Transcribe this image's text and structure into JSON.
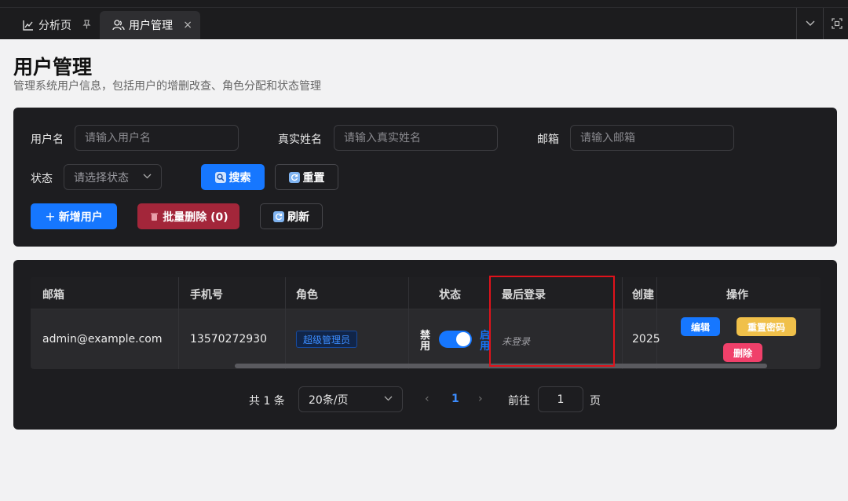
{
  "tabs": [
    {
      "label": "分析页",
      "icon": "chart-icon",
      "pin": "pin-icon"
    },
    {
      "label": "用户管理",
      "icon": "users-icon",
      "close": "×"
    }
  ],
  "header": {
    "title": "用户管理",
    "subtitle": "管理系统用户信息，包括用户的增删改查、角色分配和状态管理"
  },
  "filters": {
    "username_label": "用户名",
    "username_placeholder": "请输入用户名",
    "realname_label": "真实姓名",
    "realname_placeholder": "请输入真实姓名",
    "email_label": "邮箱",
    "email_placeholder": "请输入邮箱",
    "status_label": "状态",
    "status_placeholder": "请选择状态",
    "search_label": "搜索",
    "reset_label": "重置"
  },
  "actions": {
    "add_label": "新增用户",
    "batch_delete_label": "批量删除 (0)",
    "refresh_label": "刷新"
  },
  "table": {
    "columns": [
      "邮箱",
      "手机号",
      "角色",
      "状态",
      "最后登录",
      "创建",
      "操作"
    ],
    "rows": [
      {
        "email": "admin@example.com",
        "phone": "13570272930",
        "role": "超级管理员",
        "status_off": "禁用",
        "status_on": "启用",
        "status_enabled": true,
        "last_login": "未登录",
        "created": "2025",
        "ops": {
          "edit": "编辑",
          "reset_pwd": "重置密码",
          "delete": "删除"
        }
      }
    ]
  },
  "pagination": {
    "total_text": "共 1 条",
    "page_size": "20条/页",
    "current_page": "1",
    "goto_label": "前往",
    "goto_value": "1",
    "page_unit": "页"
  },
  "colors": {
    "primary": "#1677ff",
    "danger": "#a3263a",
    "warning": "#f0c04a",
    "delete": "#f0406a",
    "highlight": "#e0121b"
  }
}
